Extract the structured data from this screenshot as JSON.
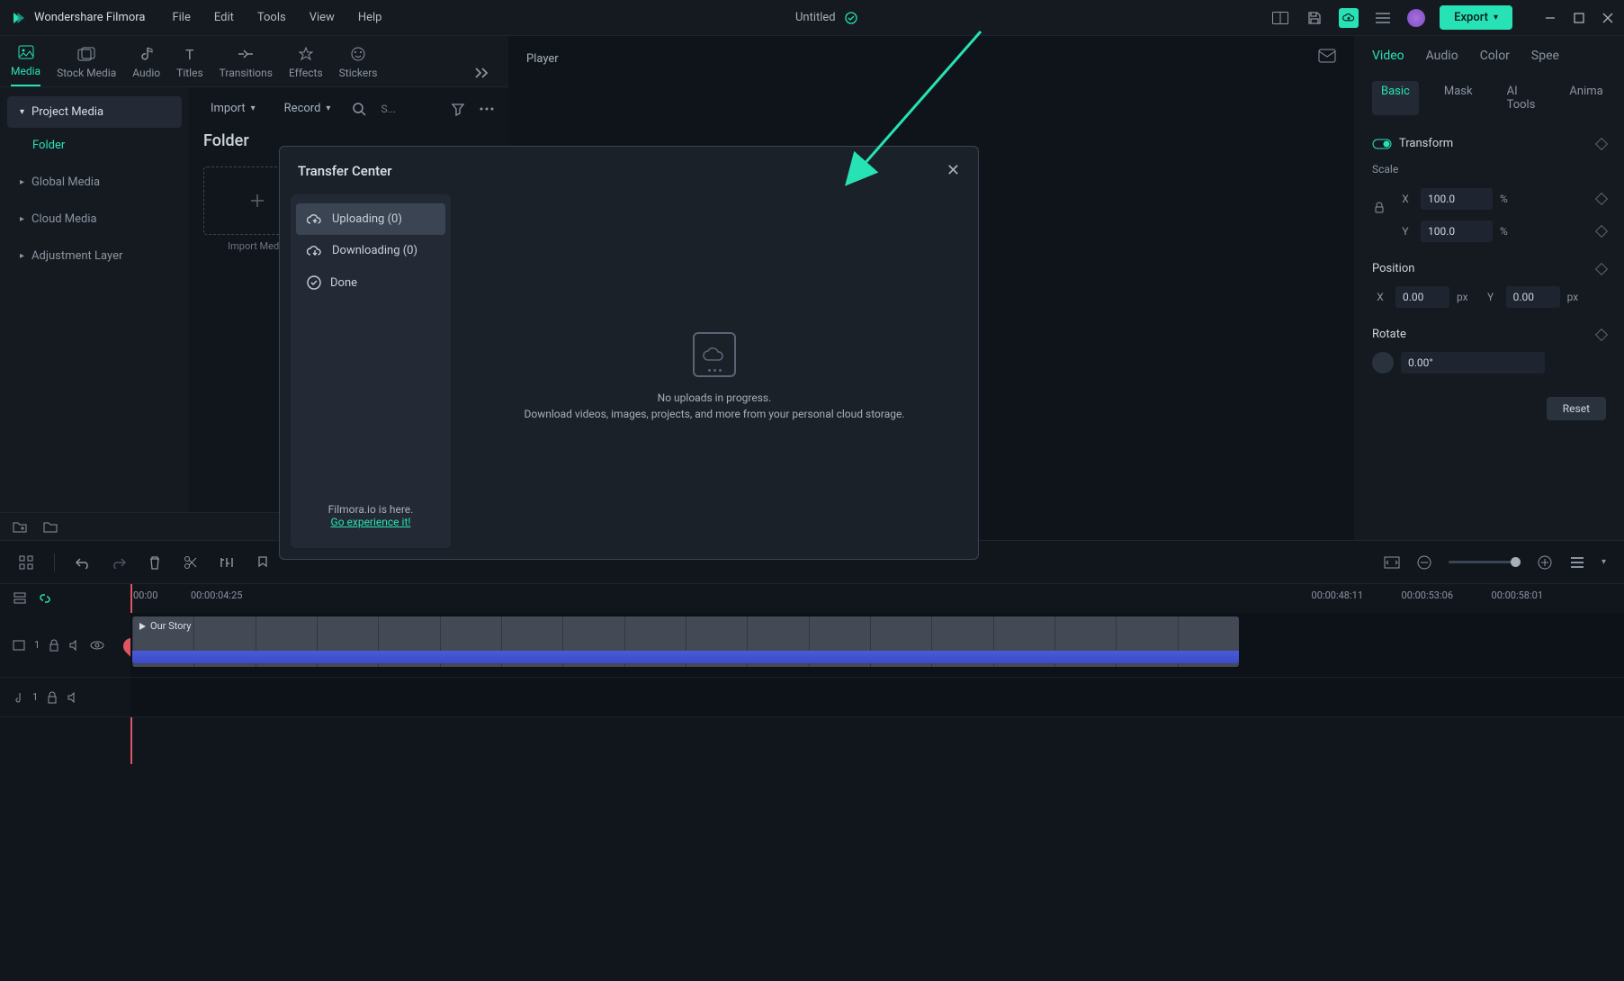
{
  "titlebar": {
    "app_name": "Wondershare Filmora",
    "menus": [
      "File",
      "Edit",
      "Tools",
      "View",
      "Help"
    ],
    "document": "Untitled",
    "export_label": "Export"
  },
  "tool_tabs": [
    "Media",
    "Stock Media",
    "Audio",
    "Titles",
    "Transitions",
    "Effects",
    "Stickers"
  ],
  "media_sidebar": {
    "header": "Project Media",
    "folder": "Folder",
    "items": [
      "Global Media",
      "Cloud Media",
      "Adjustment Layer"
    ]
  },
  "browser": {
    "import": "Import",
    "record": "Record",
    "search_placeholder": "S...",
    "title": "Folder",
    "import_tile": "Import Media"
  },
  "player": {
    "title": "Player"
  },
  "props": {
    "tabs": [
      "Video",
      "Audio",
      "Color",
      "Spee"
    ],
    "subtabs": [
      "Basic",
      "Mask",
      "AI Tools",
      "Anima"
    ],
    "transform": "Transform",
    "scale": "Scale",
    "scale_x_label": "X",
    "scale_x": "100.0",
    "scale_x_unit": "%",
    "scale_y_label": "Y",
    "scale_y": "100.0",
    "scale_y_unit": "%",
    "position": "Position",
    "pos_x_label": "X",
    "pos_x": "0.00",
    "pos_x_unit": "px",
    "pos_y_label": "Y",
    "pos_y": "0.00",
    "pos_y_unit": "px",
    "rotate": "Rotate",
    "rotate_val": "0.00°",
    "reset": "Reset"
  },
  "timeline": {
    "ruler": [
      "00:00",
      "00:00:04:25"
    ],
    "ruler_right": [
      "00:00:48:11",
      "00:00:53:06",
      "00:00:58:01"
    ],
    "clip_name": "Our Story",
    "video_track": "1",
    "audio_track": "1"
  },
  "modal": {
    "title": "Transfer Center",
    "tabs": {
      "uploading": "Uploading (0)",
      "downloading": "Downloading (0)",
      "done": "Done"
    },
    "empty1": "No uploads in progress.",
    "empty2": "Download videos, images, projects, and more from your personal cloud storage.",
    "footer1": "Filmora.io is here.",
    "footer2": "Go experience it!"
  }
}
